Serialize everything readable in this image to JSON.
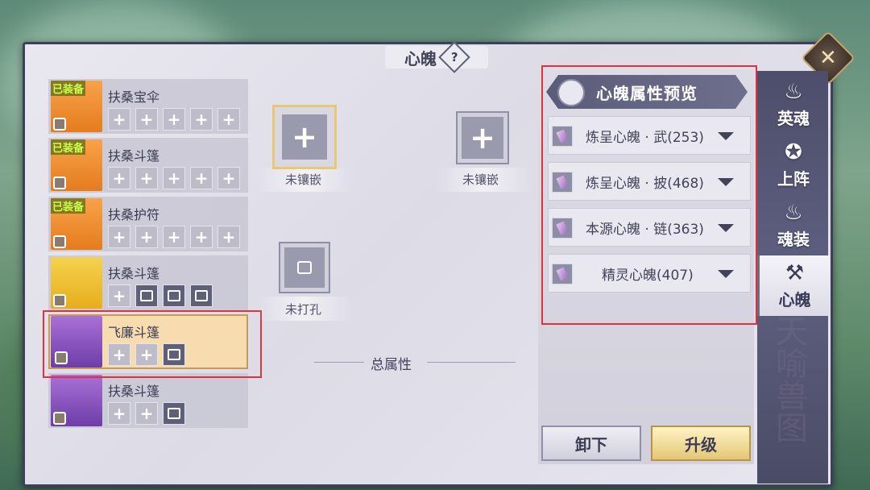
{
  "title": "心魄",
  "help_symbol": "?",
  "close_symbol": "✕",
  "equipment_list": [
    {
      "name": "扶桑宝伞",
      "badge": "已装备",
      "color": "orange",
      "slots": [
        "plus",
        "plus",
        "plus",
        "plus",
        "plus"
      ]
    },
    {
      "name": "扶桑斗篷",
      "badge": "已装备",
      "color": "orange",
      "slots": [
        "plus",
        "plus",
        "plus",
        "plus",
        "plus"
      ]
    },
    {
      "name": "扶桑护符",
      "badge": "已装备",
      "color": "orange",
      "slots": [
        "plus",
        "plus",
        "plus",
        "plus",
        "plus"
      ]
    },
    {
      "name": "扶桑斗篷",
      "badge": "",
      "color": "yellow",
      "slots": [
        "plus",
        "lock",
        "lock",
        "lock"
      ]
    },
    {
      "name": "飞廉斗篷",
      "badge": "",
      "color": "purple",
      "slots": [
        "plus",
        "plus",
        "lock"
      ],
      "selected": true
    },
    {
      "name": "扶桑斗篷",
      "badge": "",
      "color": "purple",
      "slots": [
        "plus",
        "plus",
        "lock"
      ]
    }
  ],
  "sockets": {
    "slot1_label": "未镶嵌",
    "slot2_label": "未镶嵌",
    "slot3_label": "未打孔",
    "plus_symbol": "+"
  },
  "total_attributes_label": "总属性",
  "preview": {
    "title": "心魄属性预览",
    "items": [
      {
        "label": "炼呈心魄 · 武(253)"
      },
      {
        "label": "炼呈心魄 · 披(468)"
      },
      {
        "label": "本源心魄 · 链(363)"
      },
      {
        "label": "精灵心魄(407)"
      }
    ]
  },
  "buttons": {
    "unequip": "卸下",
    "upgrade": "升级"
  },
  "side_tabs": [
    {
      "label": "英魂",
      "icon": "flame-icon"
    },
    {
      "label": "上阵",
      "icon": "pentagram-icon"
    },
    {
      "label": "魂装",
      "icon": "flame-icon"
    },
    {
      "label": "心魄",
      "icon": "hammer-anvil-icon",
      "active": true
    }
  ],
  "decor_text": "天喻兽图",
  "colors": {
    "highlight_red": "#e0323a",
    "gold": "#e9c874",
    "selected_bg": "#f7dcb0"
  }
}
